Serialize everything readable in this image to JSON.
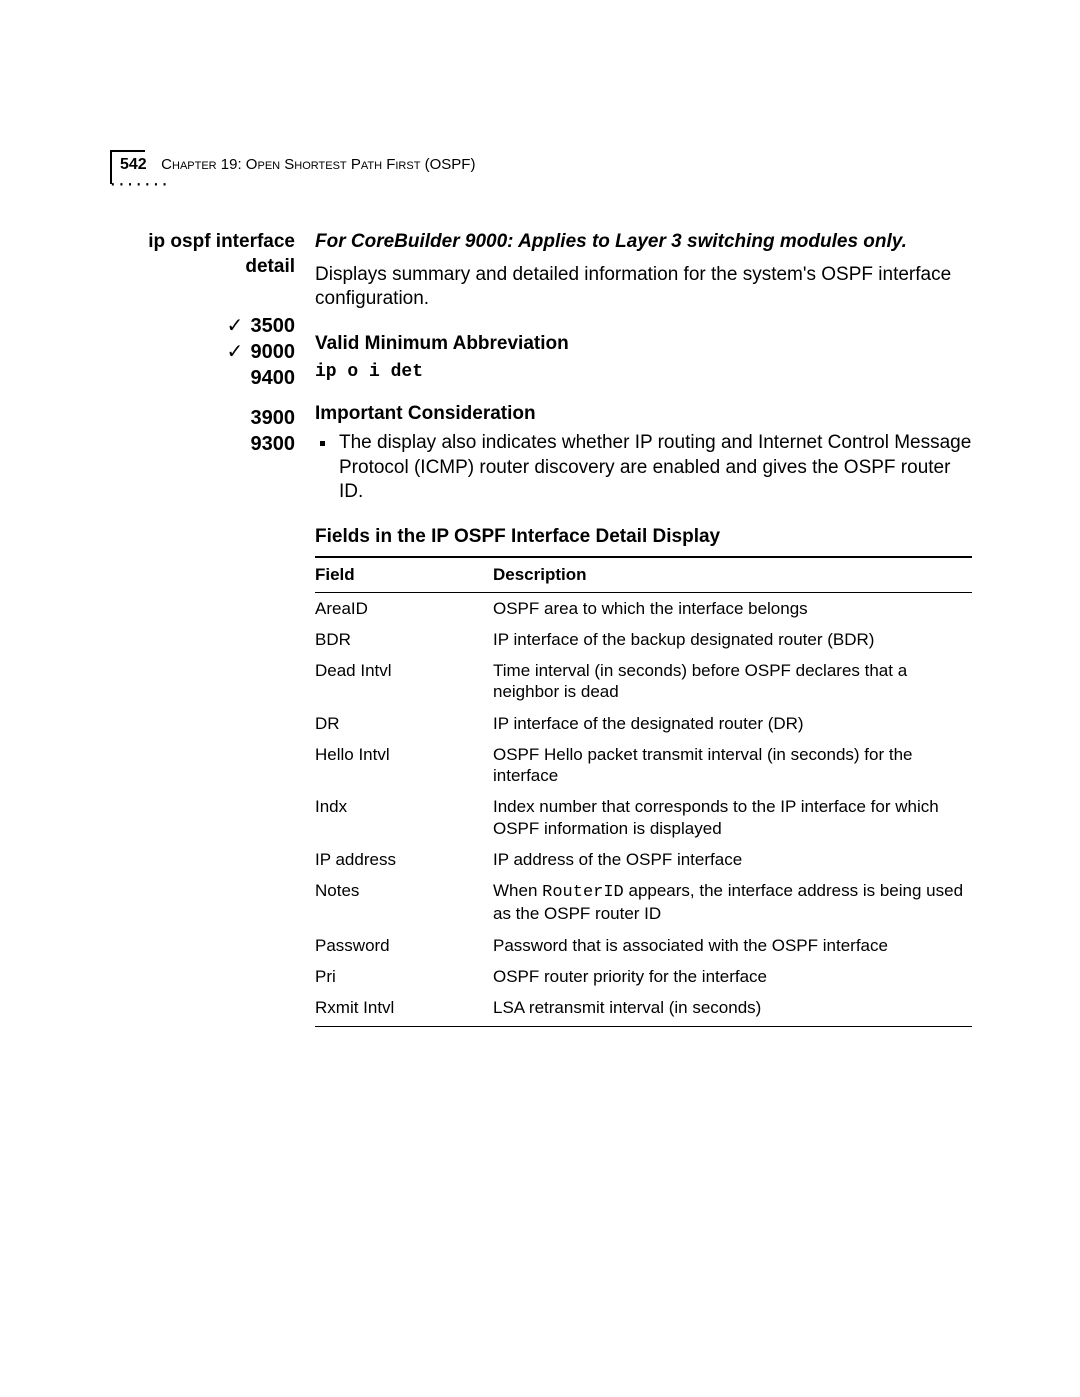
{
  "header": {
    "page_number": "542",
    "chapter_label": "Chapter 19: Open Shortest Path First (OSPF)"
  },
  "left": {
    "command_name": "ip ospf interface detail",
    "models": [
      {
        "check": "✓",
        "num": "3500"
      },
      {
        "check": "✓",
        "num": "9000"
      },
      {
        "check": "",
        "num": "9400"
      },
      {
        "check": "",
        "num": "3900"
      },
      {
        "check": "",
        "num": "9300"
      }
    ]
  },
  "body": {
    "scope_note": "For CoreBuilder 9000: Applies to Layer 3 switching modules only.",
    "intro": "Displays summary and detailed information for the system's OSPF interface configuration.",
    "abbrev_heading": "Valid Minimum Abbreviation",
    "abbrev_code": "ip o i det",
    "consideration_heading": "Important Consideration",
    "consideration_bullet": "The display also indicates whether IP routing and Internet Control Message Protocol (ICMP) router discovery are enabled and gives the OSPF router ID.",
    "fields_heading": "Fields in the IP OSPF Interface Detail Display",
    "table": {
      "col_field": "Field",
      "col_desc": "Description",
      "rows": [
        {
          "field": "AreaID",
          "desc": "OSPF area to which the interface belongs"
        },
        {
          "field": "BDR",
          "desc": "IP interface of the backup designated router (BDR)"
        },
        {
          "field": "Dead Intvl",
          "desc": "Time interval (in seconds) before OSPF declares that a neighbor is dead"
        },
        {
          "field": "DR",
          "desc": "IP interface of the designated router (DR)"
        },
        {
          "field": "Hello Intvl",
          "desc": "OSPF Hello packet transmit interval (in seconds) for the interface"
        },
        {
          "field": "Indx",
          "desc": "Index number that corresponds to the IP interface for which OSPF information is displayed"
        },
        {
          "field": "IP address",
          "desc": "IP address of the OSPF interface"
        },
        {
          "field": "Notes",
          "desc_pre": "When ",
          "code": "RouterID",
          "desc_post": " appears, the interface address is being used as the OSPF router ID"
        },
        {
          "field": "Password",
          "desc": "Password that is associated with the OSPF interface"
        },
        {
          "field": "Pri",
          "desc": "OSPF router priority for the interface"
        },
        {
          "field": "Rxmit Intvl",
          "desc": "LSA retransmit interval (in seconds)"
        }
      ]
    }
  }
}
